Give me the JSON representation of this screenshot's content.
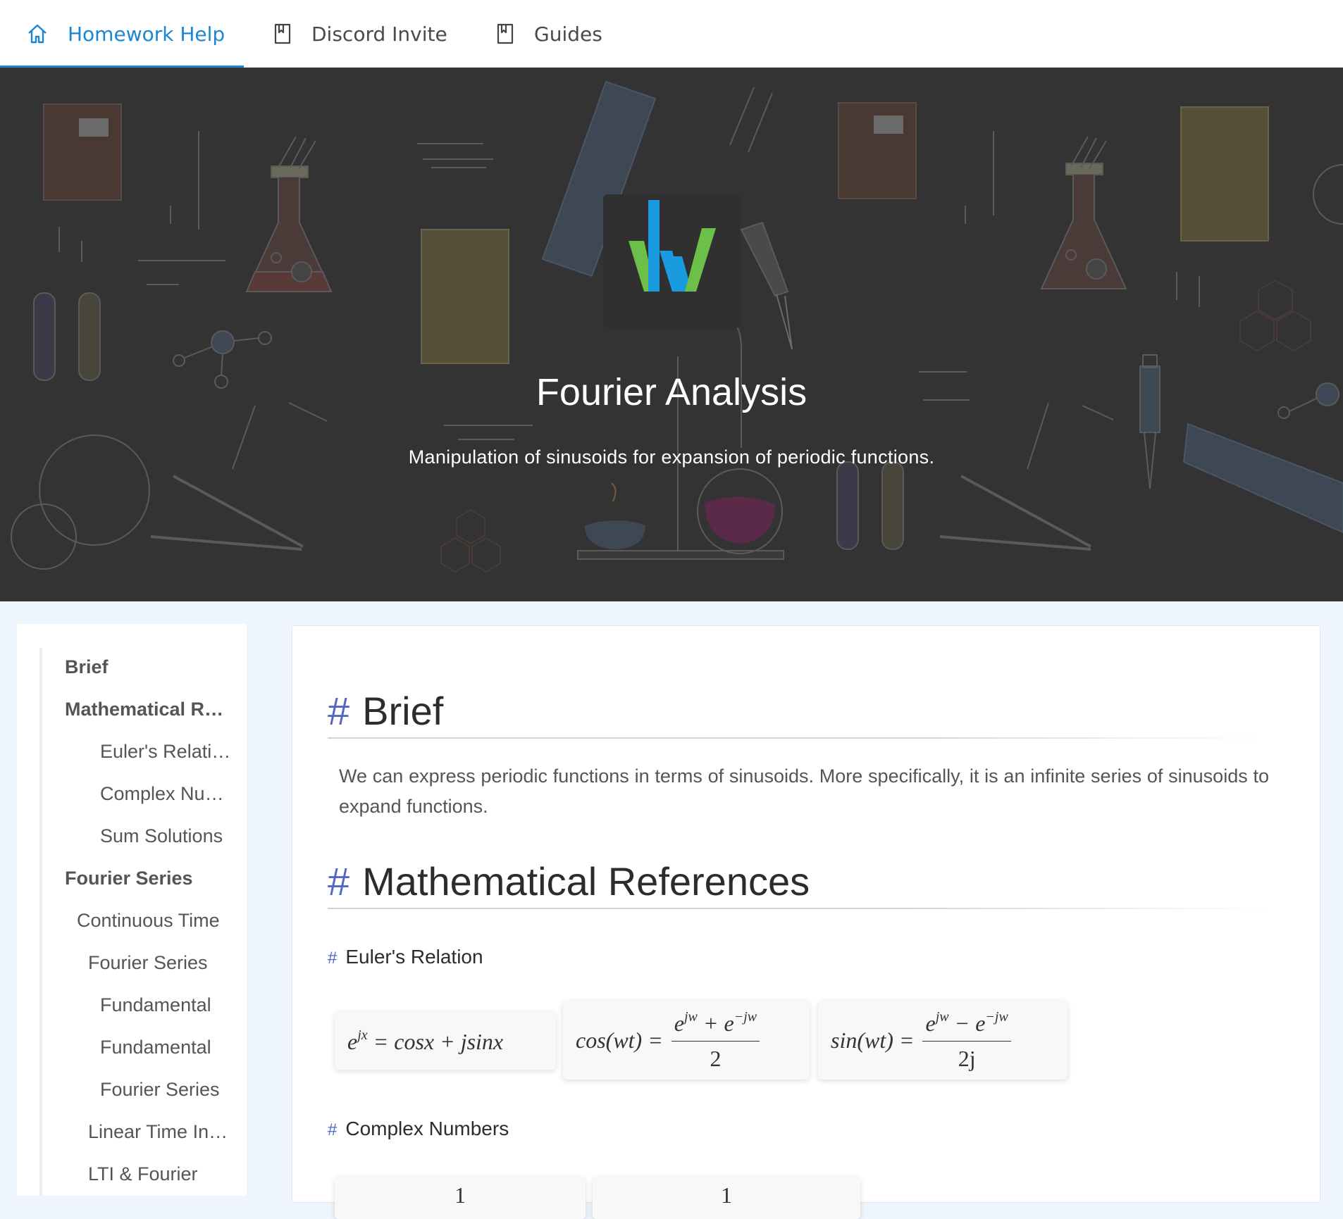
{
  "nav": {
    "tabs": [
      {
        "label": "Homework Help",
        "icon": "home-icon",
        "active": true
      },
      {
        "label": "Discord Invite",
        "icon": "bookmark-icon",
        "active": false
      },
      {
        "label": "Guides",
        "icon": "bookmark-icon",
        "active": false
      }
    ]
  },
  "hero": {
    "title": "Fourier Analysis",
    "subtitle": "Manipulation of sinusoids for expansion of periodic functions."
  },
  "toc": [
    {
      "label": "Brief",
      "level": 1
    },
    {
      "label": "Mathematical References",
      "level": 1
    },
    {
      "label": "Euler's Relation",
      "level": 4
    },
    {
      "label": "Complex Numbers",
      "level": 4
    },
    {
      "label": "Sum Solutions",
      "level": 4
    },
    {
      "label": "Fourier Series",
      "level": 1
    },
    {
      "label": "Continuous Time",
      "level": 2
    },
    {
      "label": "Fourier Series",
      "level": 3
    },
    {
      "label": "Fundamental",
      "level": 4
    },
    {
      "label": "Fundamental",
      "level": 4
    },
    {
      "label": "Fourier Series",
      "level": 4
    },
    {
      "label": "Linear Time Invariant",
      "level": 3
    },
    {
      "label": "LTI & Fourier",
      "level": 3
    }
  ],
  "content": {
    "brief_heading": "Brief",
    "brief_text": "We can express periodic functions in terms of sinusoids. More specifically, it is an infinite series of sinusoids to expand functions.",
    "math_heading": "Mathematical References",
    "euler_heading": "Euler's Relation",
    "complex_heading": "Complex Numbers",
    "hash": "#"
  },
  "colors": {
    "accent": "#1a86d6",
    "heading_hash": "#5067c8",
    "hero_bg": "#333333"
  }
}
